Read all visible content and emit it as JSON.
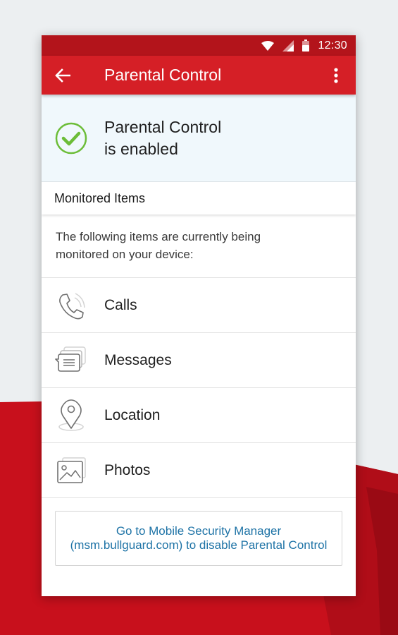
{
  "status_bar": {
    "time": "12:30",
    "icons": [
      "wifi-icon",
      "signal-icon",
      "battery-icon"
    ]
  },
  "app_bar": {
    "title": "Parental Control",
    "back_icon": "back-arrow-icon",
    "menu_icon": "more-vert-icon"
  },
  "status": {
    "line1": "Parental Control",
    "line2": "is enabled",
    "icon": "check-circle-icon"
  },
  "section": {
    "title": "Monitored Items"
  },
  "description": {
    "line1": "The following items are currently being",
    "line2": "monitored on your device:"
  },
  "items": [
    {
      "label": "Calls",
      "icon": "phone-icon"
    },
    {
      "label": "Messages",
      "icon": "messages-icon"
    },
    {
      "label": "Location",
      "icon": "location-pin-icon"
    },
    {
      "label": "Photos",
      "icon": "photos-icon"
    }
  ],
  "info": {
    "line1": "Go to Mobile Security Manager",
    "line2": "(msm.bullguard.com) to disable Parental Control"
  },
  "colors": {
    "brand_red": "#d51f26",
    "status_bar_red": "#b3141b",
    "check_green": "#6cbd38",
    "link_blue": "#1e73a6",
    "banner_bg": "#f0f8fc"
  }
}
